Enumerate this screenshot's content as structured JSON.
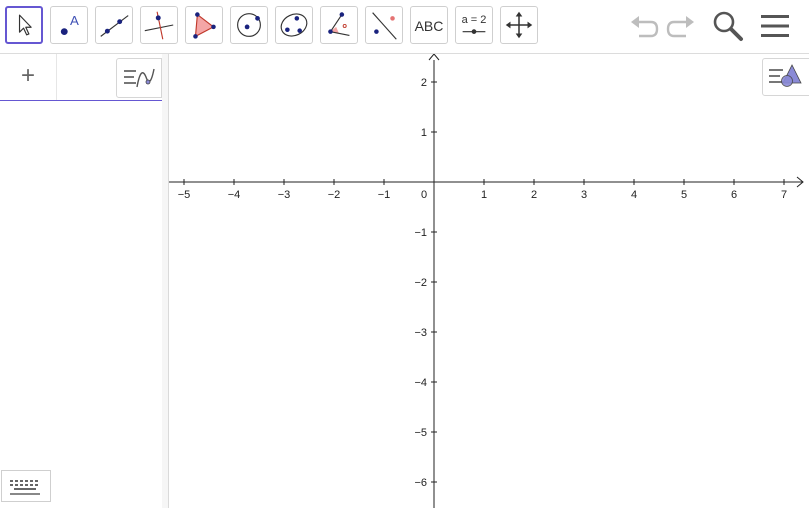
{
  "toolbar": {
    "tools": [
      {
        "id": "move",
        "icon": "pointer-arrow-icon",
        "label": ""
      },
      {
        "id": "point",
        "icon": "point-icon",
        "label": ""
      },
      {
        "id": "line",
        "icon": "line-icon",
        "label": ""
      },
      {
        "id": "perpendicular",
        "icon": "perpendicular-line-icon",
        "label": ""
      },
      {
        "id": "polygon",
        "icon": "polygon-icon",
        "label": ""
      },
      {
        "id": "circle",
        "icon": "circle-center-point-icon",
        "label": ""
      },
      {
        "id": "conic",
        "icon": "ellipse-icon",
        "label": ""
      },
      {
        "id": "angle",
        "icon": "angle-icon",
        "label": ""
      },
      {
        "id": "reflect",
        "icon": "reflect-line-icon",
        "label": ""
      },
      {
        "id": "text",
        "icon": "text-icon",
        "label": "ABC"
      },
      {
        "id": "slider",
        "icon": "slider-icon",
        "label": "a = 2"
      },
      {
        "id": "move-graphics",
        "icon": "move-graphics-icon",
        "label": ""
      }
    ],
    "point_label": "A",
    "undo_icon": "undo-icon",
    "redo_icon": "redo-icon",
    "search_icon": "search-icon",
    "menu_icon": "hamburger-menu-icon"
  },
  "algebra": {
    "add_label": "+",
    "menu_icon": "algebra-style-icon",
    "keyboard_icon": "keyboard-icon"
  },
  "graphics": {
    "style_icon": "graphics-style-icon",
    "x_ticks": [
      "−5",
      "−4",
      "−3",
      "−2",
      "−1",
      "0",
      "1",
      "2",
      "3",
      "4",
      "5",
      "6",
      "7"
    ],
    "y_ticks": [
      "2",
      "1",
      "−1",
      "−2",
      "−3",
      "−4",
      "−5",
      "−6"
    ]
  },
  "colors": {
    "accent": "#6557d2",
    "point": "#1a237e",
    "polygon_fill": "#f4a6a6",
    "polygon_stroke": "#c0392b"
  }
}
